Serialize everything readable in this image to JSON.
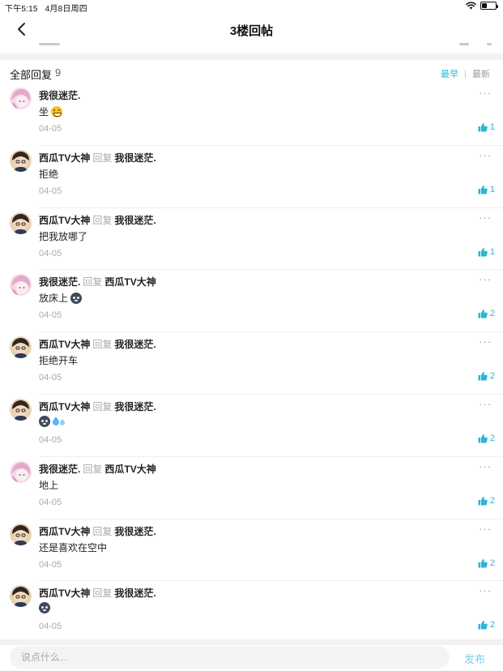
{
  "status_bar": {
    "time": "下午5:15",
    "date": "4月8日周四",
    "battery_level": 0.4
  },
  "nav": {
    "title": "3楼回帖"
  },
  "replies_header": {
    "title": "全部回复",
    "count": "9",
    "sort_options": [
      "最早",
      "最新"
    ],
    "active_sort": "最早"
  },
  "reply_word": "回复",
  "users": {
    "a": {
      "name": "我很迷茫.",
      "avatar": "pink"
    },
    "b": {
      "name": "西瓜TV大神",
      "avatar": "dark"
    }
  },
  "replies": [
    {
      "author": "我很迷茫.",
      "avatar": "pink",
      "reply_to": "",
      "text": "坐",
      "emojis": [
        "grin"
      ],
      "date": "04-05",
      "likes": "1"
    },
    {
      "author": "西瓜TV大神",
      "avatar": "dark",
      "reply_to": "我很迷茫.",
      "text": "拒绝",
      "emojis": [],
      "date": "04-05",
      "likes": "1"
    },
    {
      "author": "西瓜TV大神",
      "avatar": "dark",
      "reply_to": "我很迷茫.",
      "text": "把我放哪了",
      "emojis": [],
      "date": "04-05",
      "likes": "1"
    },
    {
      "author": "我很迷茫.",
      "avatar": "pink",
      "reply_to": "西瓜TV大神",
      "text": "放床上",
      "emojis": [
        "dark"
      ],
      "date": "04-05",
      "likes": "2"
    },
    {
      "author": "西瓜TV大神",
      "avatar": "dark",
      "reply_to": "我很迷茫.",
      "text": "拒绝开车",
      "emojis": [],
      "date": "04-05",
      "likes": "2"
    },
    {
      "author": "西瓜TV大神",
      "avatar": "dark",
      "reply_to": "我很迷茫.",
      "text": "",
      "emojis": [
        "dark",
        "sweat"
      ],
      "date": "04-05",
      "likes": "2"
    },
    {
      "author": "我很迷茫.",
      "avatar": "pink",
      "reply_to": "西瓜TV大神",
      "text": "地上",
      "emojis": [],
      "date": "04-05",
      "likes": "2"
    },
    {
      "author": "西瓜TV大神",
      "avatar": "dark",
      "reply_to": "我很迷茫.",
      "text": "还是喜欢在空中",
      "emojis": [],
      "date": "04-05",
      "likes": "2"
    },
    {
      "author": "西瓜TV大神",
      "avatar": "dark",
      "reply_to": "我很迷茫.",
      "text": "",
      "emojis": [
        "dark"
      ],
      "date": "04-05",
      "likes": "2"
    }
  ],
  "comment_bar": {
    "placeholder": "说点什么...",
    "send_label": "发布"
  },
  "colors": {
    "accent": "#2bb6d6",
    "send_inactive": "#7dcfe6",
    "muted": "#aaaaaa"
  }
}
